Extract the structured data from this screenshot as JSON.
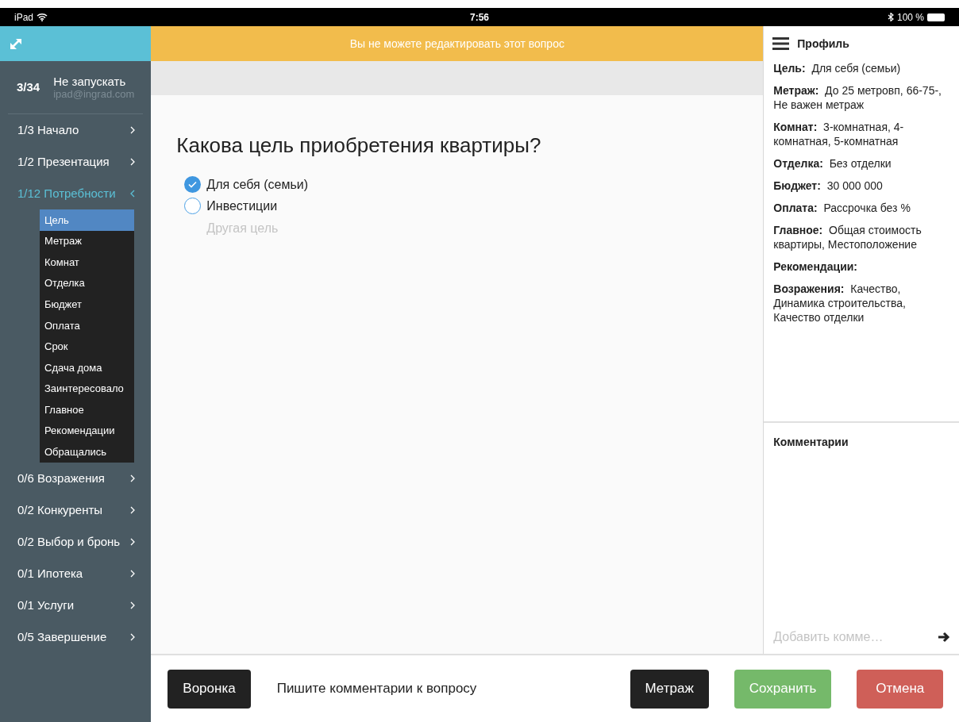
{
  "status_bar": {
    "device": "iPad",
    "time": "7:56",
    "battery": "100 %"
  },
  "sidebar": {
    "counter": "3/34",
    "title": "Не запускать",
    "email": "ipad@ingrad.com",
    "sections": [
      {
        "label": "1/3 Начало",
        "expanded": false
      },
      {
        "label": "1/2 Презентация",
        "expanded": false
      },
      {
        "label": "1/12 Потребности",
        "expanded": true,
        "children": [
          {
            "label": "Цель",
            "selected": true
          },
          {
            "label": "Метраж",
            "selected": false
          },
          {
            "label": "Комнат",
            "selected": false
          },
          {
            "label": "Отделка",
            "selected": false
          },
          {
            "label": "Бюджет",
            "selected": false
          },
          {
            "label": "Оплата",
            "selected": false
          },
          {
            "label": "Срок",
            "selected": false
          },
          {
            "label": "Сдача дома",
            "selected": false
          },
          {
            "label": "Заинтересовало",
            "selected": false
          },
          {
            "label": "Главное",
            "selected": false
          },
          {
            "label": "Рекомендации",
            "selected": false
          },
          {
            "label": "Обращались",
            "selected": false
          }
        ]
      },
      {
        "label": "0/6 Возражения",
        "expanded": false
      },
      {
        "label": "0/2 Конкуренты",
        "expanded": false
      },
      {
        "label": "0/2 Выбор и бронь",
        "expanded": false
      },
      {
        "label": "0/1 Ипотека",
        "expanded": false
      },
      {
        "label": "0/1 Услуги",
        "expanded": false
      },
      {
        "label": "0/5 Завершение",
        "expanded": false
      }
    ]
  },
  "banner": "Вы не можете редактировать этот вопрос",
  "question": {
    "title": "Какова цель приобретения квартиры?",
    "options": [
      {
        "label": "Для себя (семьи)",
        "checked": true
      },
      {
        "label": "Инвестиции",
        "checked": false
      }
    ],
    "other_placeholder": "Другая цель"
  },
  "profile": {
    "title": "Профиль",
    "fields": [
      {
        "label": "Цель:",
        "value": "Для себя (семьи)"
      },
      {
        "label": "Метраж:",
        "value": "До 25 метровп, 66-75-, Не важен метраж"
      },
      {
        "label": "Комнат:",
        "value": "3-комнатная, 4-комнатная, 5-комнатная"
      },
      {
        "label": "Отделка:",
        "value": "Без отделки"
      },
      {
        "label": "Бюджет:",
        "value": "30 000 000"
      },
      {
        "label": "Оплата:",
        "value": "Рассрочка без %"
      },
      {
        "label": "Главное:",
        "value": "Общая стоимость квартиры, Местоположение"
      },
      {
        "label": "Рекомендации:"
      },
      {
        "label": "Возражения:",
        "value": "Качество, Динамика строительства, Качество отделки"
      }
    ]
  },
  "comments": {
    "title": "Комментарии",
    "placeholder": "Добавить комме…"
  },
  "footer": {
    "hint": "Пишите комментарии к вопросу",
    "buttons": [
      {
        "label": "Воронка",
        "kind": "dark"
      },
      {
        "label": "Метраж",
        "kind": "dark"
      },
      {
        "label": "Сохранить",
        "kind": "success"
      },
      {
        "label": "Отмена",
        "kind": "danger"
      }
    ]
  }
}
